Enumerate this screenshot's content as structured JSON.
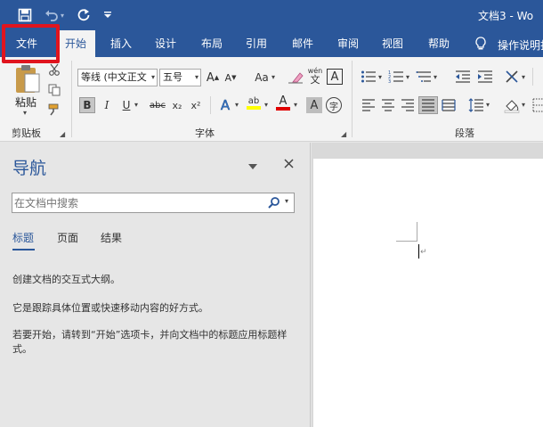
{
  "title_bar": {
    "doc_title": "文档3 - Wo",
    "save_icon": "save-icon",
    "undo_icon": "undo-icon",
    "redo_icon": "redo-icon",
    "customize_icon": "customize-qat-icon"
  },
  "menu": {
    "tabs": [
      "文件",
      "开始",
      "插入",
      "设计",
      "布局",
      "引用",
      "邮件",
      "审阅",
      "视图",
      "帮助"
    ],
    "tell_me": "操作说明打"
  },
  "ribbon": {
    "clipboard": {
      "paste_label": "粘贴",
      "group_label": "剪贴板"
    },
    "font": {
      "font_name": "等线 (中文正文",
      "font_size": "五号",
      "group_label": "字体",
      "bold": "B",
      "italic": "I",
      "underline": "U",
      "strikethrough": "abc",
      "subscript": "x₂",
      "superscript": "x²",
      "grow": "A",
      "shrink": "A",
      "case": "Aa",
      "char_border": "A",
      "text_effects": "A",
      "highlight": "ab",
      "font_color": "A",
      "char_shading": "A",
      "phonetic": "wén",
      "enclose": "字"
    },
    "paragraph": {
      "group_label": "段落"
    }
  },
  "nav_pane": {
    "title": "导航",
    "search_placeholder": "在文档中搜索",
    "tabs": [
      "标题",
      "页面",
      "结果"
    ],
    "para1": "创建文档的交互式大纲。",
    "para2": "它是跟踪具体位置或快速移动内容的好方式。",
    "para3": "若要开始，请转到“开始”选项卡，并向文档中的标题应用标题样式。"
  },
  "colors": {
    "accent": "#2b579a",
    "highlight_box": "#e0141e",
    "highlight_yellow": "#ffff00",
    "font_color_red": "#e00000"
  }
}
